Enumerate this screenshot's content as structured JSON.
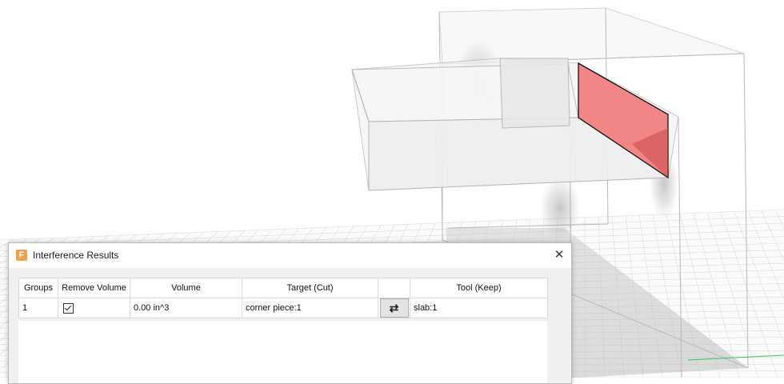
{
  "dialog": {
    "title": "Interference Results",
    "app_icon_letter": "F",
    "close_glyph": "✕"
  },
  "table": {
    "headers": [
      "Groups",
      "Remove Volume",
      "Volume",
      "Target (Cut)",
      "",
      "Tool (Keep)"
    ],
    "rows": [
      {
        "group": "1",
        "remove_volume": true,
        "volume": "0.00 in^3",
        "target": "corner piece:1",
        "swap_glyph": "⇄",
        "tool": "slab:1"
      }
    ]
  },
  "colors": {
    "interference": "#f08080",
    "interference_shade": "#c84848",
    "grid_line": "#d6d6d6",
    "edge": "#b9b9b9",
    "accent_icon": "#f0a04a"
  }
}
